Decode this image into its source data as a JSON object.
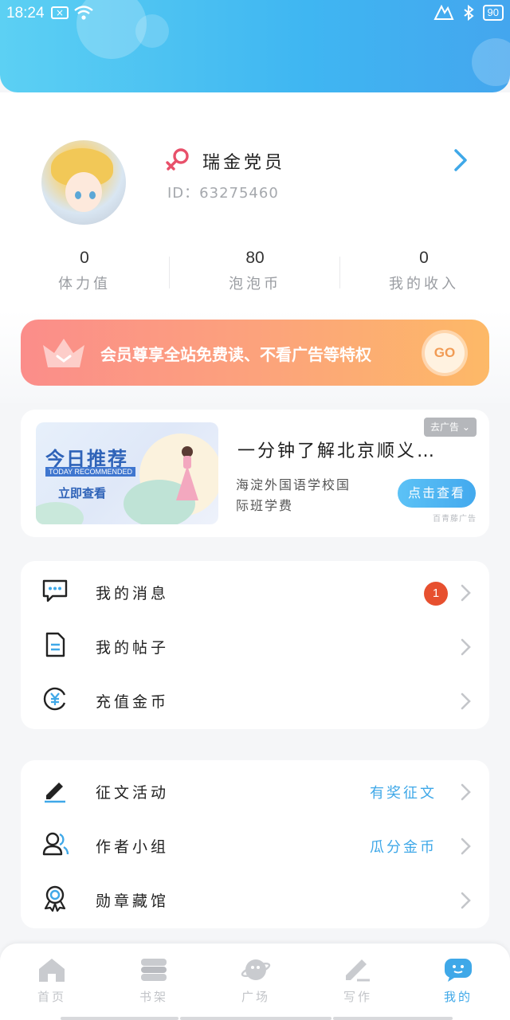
{
  "status_bar": {
    "time": "18:24",
    "battery": "90"
  },
  "profile": {
    "username": "瑞金党员",
    "user_id": "ID：63275460",
    "gender_icon": "female-symbol",
    "stats": [
      {
        "value": "0",
        "label": "体力值"
      },
      {
        "value": "80",
        "label": "泡泡币"
      },
      {
        "value": "0",
        "label": "我的收入"
      }
    ]
  },
  "vip_banner": {
    "text": "会员尊享全站免费读、不看广告等特权",
    "go_label": "GO"
  },
  "ad": {
    "image_title": "今日推荐",
    "image_subtitle": "TODAY RECOMMENDED",
    "image_button": "立即查看",
    "title": "一分钟了解北京顺义…",
    "description_line1": "海淀外国语学校国",
    "description_line2": "际班学费",
    "tag": "去广告",
    "cta": "点击查看",
    "source": "百青藤广告"
  },
  "menu_group1": [
    {
      "label": "我的消息",
      "icon": "message-icon",
      "badge": "1"
    },
    {
      "label": "我的帖子",
      "icon": "document-icon"
    },
    {
      "label": "充值金币",
      "icon": "coin-yen-icon"
    }
  ],
  "menu_group2": [
    {
      "label": "征文活动",
      "icon": "pen-icon",
      "extra": "有奖征文"
    },
    {
      "label": "作者小组",
      "icon": "users-icon",
      "extra": "瓜分金币"
    },
    {
      "label": "勋章藏馆",
      "icon": "medal-icon"
    }
  ],
  "bottom_nav": [
    {
      "label": "首页",
      "icon": "home-icon"
    },
    {
      "label": "书架",
      "icon": "bookshelf-icon"
    },
    {
      "label": "广场",
      "icon": "planet-icon"
    },
    {
      "label": "写作",
      "icon": "write-icon"
    },
    {
      "label": "我的",
      "icon": "profile-bubble-icon",
      "active": true
    }
  ],
  "colors": {
    "header_gradient_start": "#5cd0f3",
    "header_gradient_end": "#44a6ee",
    "vip_gradient_start": "#fb8d8a",
    "vip_gradient_end": "#fdb967",
    "accent_blue": "#3fa8e8",
    "badge_red": "#e7502f"
  }
}
